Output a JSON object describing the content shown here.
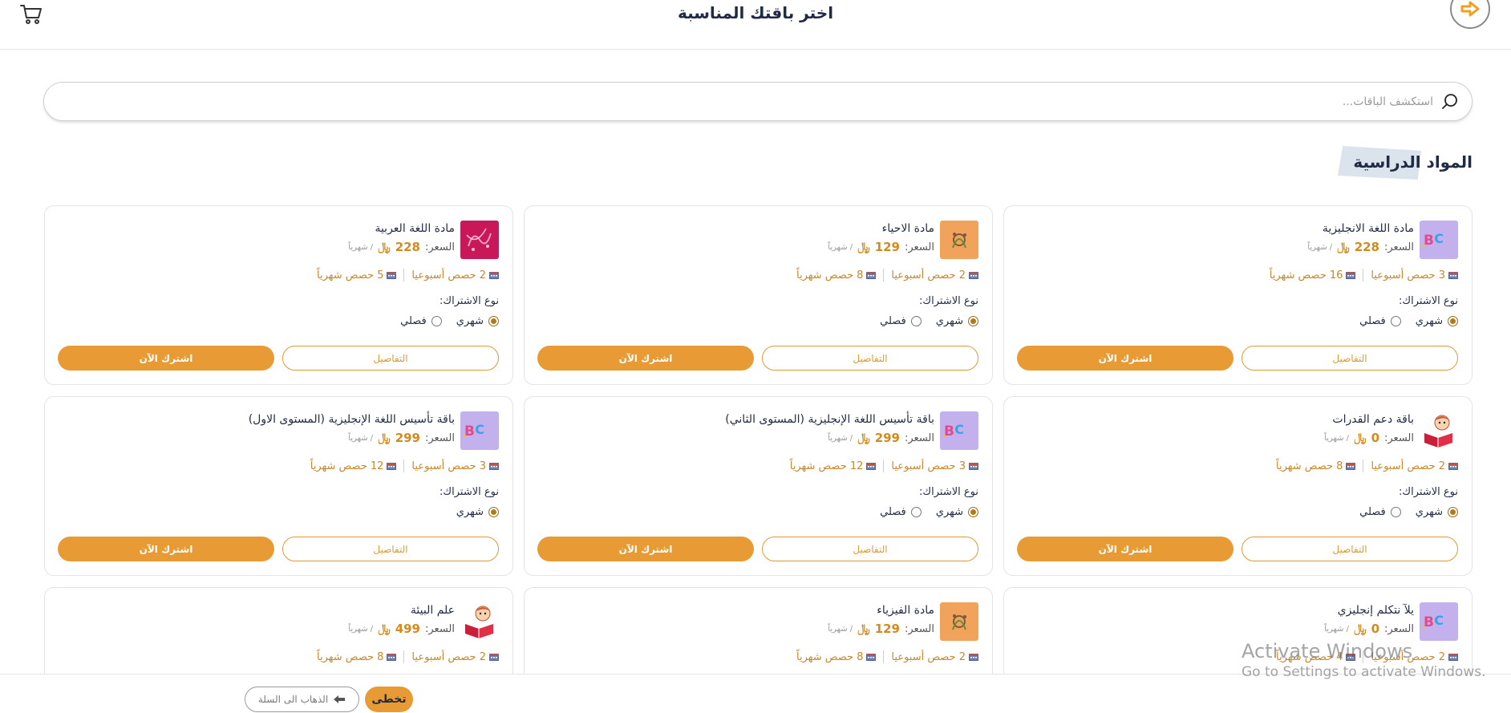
{
  "header": {
    "title": "اختر باقتك المناسبة"
  },
  "search": {
    "placeholder": "استكشف الباقات..."
  },
  "section": {
    "title": "المواد الدراسية"
  },
  "labels": {
    "price": "السعر:",
    "per_month": "/ شهرياً",
    "subscription_type": "نوع الاشتراك:",
    "monthly": "شهري",
    "term": "فصلي",
    "details": "التفاصيل",
    "subscribe": "اشترك الآن"
  },
  "cards": [
    {
      "title": "مادة اللغة الانجليزية",
      "price": "228",
      "weekly": "3 حصص أسبوعيا",
      "monthly": "16 حصص شهرياً",
      "thumb": "abc",
      "has_term": true
    },
    {
      "title": "مادة الاحياء",
      "price": "129",
      "weekly": "2 حصص أسبوعيا",
      "monthly": "8 حصص شهرياً",
      "thumb": "bio",
      "has_term": true
    },
    {
      "title": "مادة اللغة العربية",
      "price": "228",
      "weekly": "2 حصص أسبوعيا",
      "monthly": "5 حصص شهرياً",
      "thumb": "arabic",
      "has_term": true
    },
    {
      "title": "باقة دعم القدرات",
      "price": "0",
      "weekly": "2 حصص أسبوعيا",
      "monthly": "8 حصص شهرياً",
      "thumb": "kid",
      "has_term": true
    },
    {
      "title": "باقة تأسيس اللغة الإنجليزية (المستوى الثاني)",
      "price": "299",
      "weekly": "3 حصص أسبوعيا",
      "monthly": "12 حصص شهرياً",
      "thumb": "abc",
      "has_term": true
    },
    {
      "title": "باقة تأسيس اللغة الإنجليزية (المستوى الاول)",
      "price": "299",
      "weekly": "3 حصص أسبوعيا",
      "monthly": "12 حصص شهرياً",
      "thumb": "abc",
      "has_term": false
    },
    {
      "title": "يلآ نتكلم إنجليزي",
      "price": "0",
      "weekly": "2 حصص أسبوعيا",
      "monthly": "4 حصص شهرياً",
      "thumb": "abc",
      "has_term": true
    },
    {
      "title": "مادة الفيزياء",
      "price": "129",
      "weekly": "2 حصص أسبوعيا",
      "monthly": "8 حصص شهرياً",
      "thumb": "bio",
      "has_term": true
    },
    {
      "title": "علم البيئة",
      "price": "499",
      "weekly": "2 حصص أسبوعيا",
      "monthly": "8 حصص شهرياً",
      "thumb": "kid",
      "has_term": true
    }
  ],
  "bottom": {
    "skip": "تخطى",
    "go_to_cart": "الذهاب الى السلة"
  },
  "watermark": {
    "title": "Activate Windows",
    "subtitle": "Go to Settings to activate Windows."
  },
  "colors": {
    "accent": "#e89b34",
    "price": "#d48a1c",
    "text": "#1f2a44"
  }
}
